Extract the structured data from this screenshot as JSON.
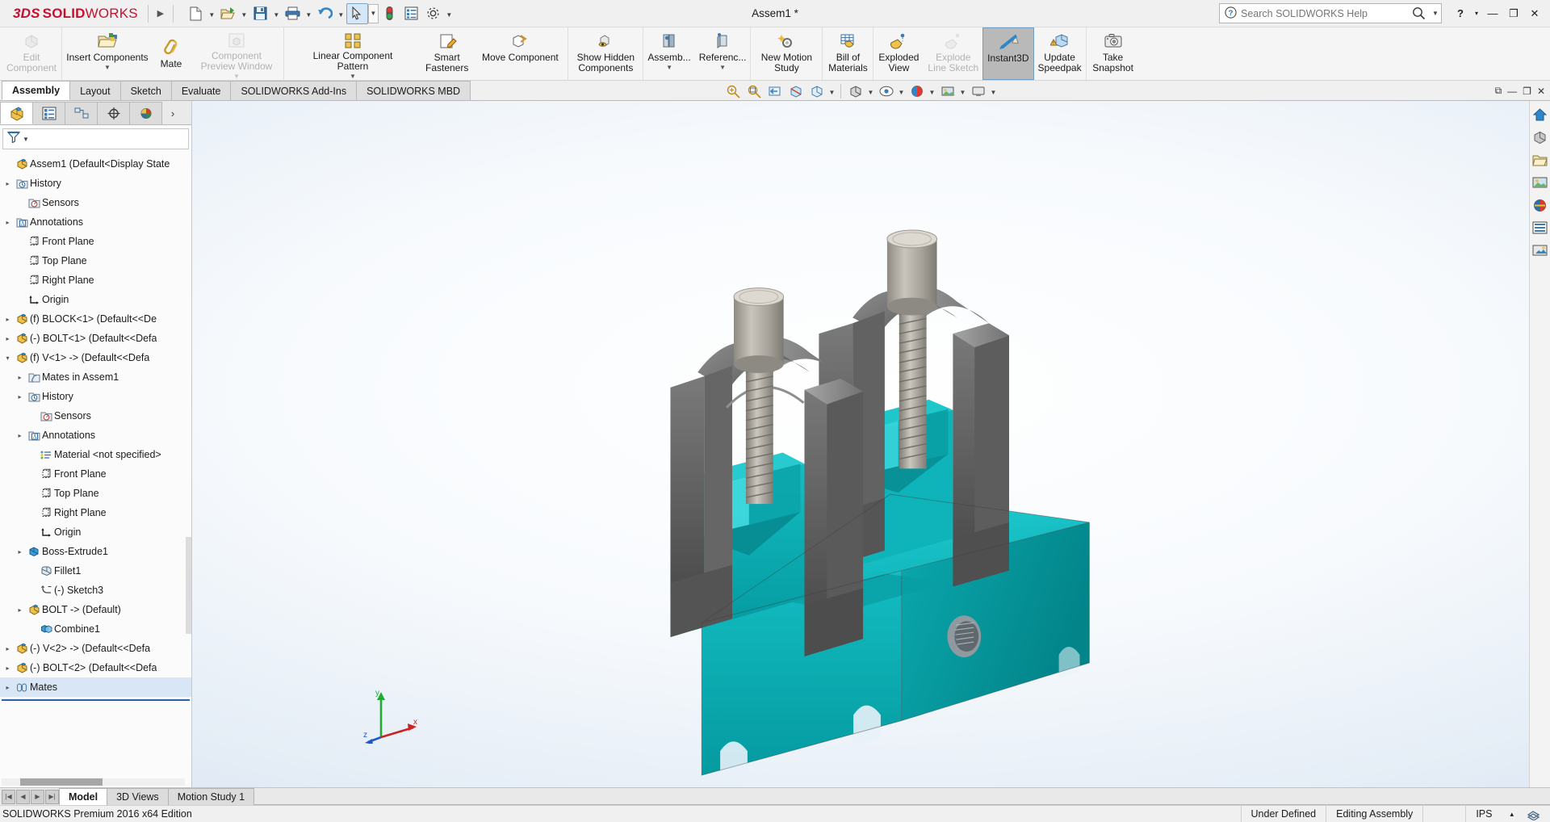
{
  "app": {
    "brand_ds": "3DS",
    "brand_solid": "SOLID",
    "brand_works": "WORKS",
    "document_title": "Assem1 *",
    "edition": "SOLIDWORKS Premium 2016 x64 Edition",
    "accent": "#c8102e",
    "selection_blue": "#d6e8f7"
  },
  "titlebar": {
    "expand_arrow": "▶",
    "quick_access": [
      {
        "name": "new-document",
        "label": "New",
        "caret": true
      },
      {
        "name": "open-document",
        "label": "Open",
        "caret": true
      },
      {
        "name": "save-document",
        "label": "Save",
        "caret": true
      },
      {
        "name": "print-document",
        "label": "Print",
        "caret": true
      },
      {
        "name": "undo",
        "label": "Undo",
        "caret": true
      },
      {
        "name": "select-tool",
        "label": "Select",
        "caret": true,
        "selected": true
      },
      {
        "name": "rebuild",
        "label": "Rebuild"
      },
      {
        "name": "file-properties",
        "label": "File Properties"
      },
      {
        "name": "options",
        "label": "Options",
        "caret": true
      }
    ],
    "search": {
      "placeholder": "Search SOLIDWORKS Help",
      "value": "",
      "help_icon": "?"
    },
    "window_buttons": [
      {
        "name": "help-button",
        "label": "?"
      },
      {
        "name": "help-caret",
        "label": "▾"
      },
      {
        "name": "minimize-button",
        "label": "—"
      },
      {
        "name": "restore-button",
        "label": "❐"
      },
      {
        "name": "close-button",
        "label": "✕"
      }
    ]
  },
  "ribbon": {
    "groups": [
      {
        "buttons": [
          {
            "name": "edit-component",
            "label": "Edit\nComponent",
            "icon": "edit-component-icon",
            "disabled": true,
            "caret": false
          }
        ]
      },
      {
        "buttons": [
          {
            "name": "insert-components",
            "label": "Insert Components",
            "icon": "insert-components-icon",
            "disabled": false,
            "caret": true
          },
          {
            "name": "mate",
            "label": "Mate",
            "icon": "mate-icon",
            "disabled": false,
            "caret": false
          },
          {
            "name": "component-preview-window",
            "label": "Component\nPreview Window",
            "icon": "component-preview-icon",
            "disabled": true,
            "caret": true
          }
        ]
      },
      {
        "buttons": [
          {
            "name": "linear-component-pattern",
            "label": "Linear Component Pattern",
            "icon": "linear-pattern-icon",
            "disabled": false,
            "caret": true
          },
          {
            "name": "smart-fasteners",
            "label": "Smart\nFasteners",
            "icon": "smart-fasteners-icon",
            "disabled": false,
            "caret": false
          },
          {
            "name": "move-component",
            "label": "Move Component",
            "icon": "move-component-icon",
            "disabled": false,
            "caret": false
          }
        ]
      },
      {
        "buttons": [
          {
            "name": "show-hidden-components",
            "label": "Show Hidden\nComponents",
            "icon": "show-hidden-icon",
            "disabled": false,
            "caret": false
          }
        ]
      },
      {
        "buttons": [
          {
            "name": "assembly-features",
            "label": "Assemb...",
            "icon": "assembly-features-icon",
            "disabled": false,
            "caret": true
          },
          {
            "name": "reference-geometry",
            "label": "Referenc...",
            "icon": "reference-geometry-icon",
            "disabled": false,
            "caret": true
          }
        ]
      },
      {
        "buttons": [
          {
            "name": "new-motion-study",
            "label": "New Motion\nStudy",
            "icon": "motion-study-icon",
            "disabled": false,
            "caret": false
          }
        ]
      },
      {
        "buttons": [
          {
            "name": "bill-of-materials",
            "label": "Bill of\nMaterials",
            "icon": "bom-icon",
            "disabled": false,
            "caret": false
          }
        ]
      },
      {
        "buttons": [
          {
            "name": "exploded-view",
            "label": "Exploded\nView",
            "icon": "exploded-view-icon",
            "disabled": false,
            "caret": false
          },
          {
            "name": "explode-line-sketch",
            "label": "Explode\nLine Sketch",
            "icon": "explode-line-icon",
            "disabled": true,
            "caret": false
          },
          {
            "name": "instant3d",
            "label": "Instant3D",
            "icon": "instant3d-icon",
            "disabled": false,
            "caret": false,
            "active": true
          },
          {
            "name": "update-speedpak",
            "label": "Update\nSpeedpak",
            "icon": "update-speedpak-icon",
            "disabled": false,
            "caret": false
          }
        ]
      },
      {
        "buttons": [
          {
            "name": "take-snapshot",
            "label": "Take\nSnapshot",
            "icon": "camera-icon",
            "disabled": false,
            "caret": false
          }
        ]
      }
    ]
  },
  "command_tabs": {
    "tabs": [
      {
        "name": "tab-assembly",
        "label": "Assembly",
        "active": true
      },
      {
        "name": "tab-layout",
        "label": "Layout",
        "active": false
      },
      {
        "name": "tab-sketch",
        "label": "Sketch",
        "active": false
      },
      {
        "name": "tab-evaluate",
        "label": "Evaluate",
        "active": false
      },
      {
        "name": "tab-solidworks-addins",
        "label": "SOLIDWORKS Add-Ins",
        "active": false
      },
      {
        "name": "tab-solidworks-mbd",
        "label": "SOLIDWORKS MBD",
        "active": false
      }
    ],
    "view_tools": [
      {
        "name": "zoom-to-fit-icon",
        "caret": false
      },
      {
        "name": "zoom-to-area-icon",
        "caret": false
      },
      {
        "name": "previous-view-icon",
        "caret": false
      },
      {
        "name": "section-view-icon",
        "caret": false
      },
      {
        "name": "view-orientation-icon",
        "caret": true
      },
      {
        "name": "display-style-icon",
        "caret": true
      },
      {
        "name": "hide-show-items-icon",
        "caret": true
      },
      {
        "name": "edit-appearance-icon",
        "caret": true
      },
      {
        "name": "apply-scene-icon",
        "caret": true
      },
      {
        "name": "view-settings-icon",
        "caret": true
      }
    ],
    "window_controls": [
      {
        "name": "restore-down-doc",
        "label": "⧉"
      },
      {
        "name": "minimize-doc",
        "label": "—"
      },
      {
        "name": "maximize-doc",
        "label": "❐"
      },
      {
        "name": "close-doc",
        "label": "✕"
      }
    ]
  },
  "feature_manager": {
    "panel_tabs": [
      {
        "name": "featuremanager-design-tree-tab",
        "icon": "yellow-cube-icon",
        "active": true
      },
      {
        "name": "property-manager-tab",
        "icon": "property-list-icon",
        "active": false
      },
      {
        "name": "configuration-manager-tab",
        "icon": "configuration-icon",
        "active": false
      },
      {
        "name": "dimxpert-manager-tab",
        "icon": "dimxpert-icon",
        "active": false
      },
      {
        "name": "display-manager-tab",
        "icon": "color-sphere-icon",
        "active": false
      }
    ],
    "panel_more": "›",
    "filter_icon": "filter-icon",
    "filter_placeholder": "",
    "tree": [
      {
        "indent": 0,
        "expander": "",
        "icon": "assembly-icon",
        "label": "Assem1  (Default<Display State"
      },
      {
        "indent": 0,
        "expander": "▸",
        "icon": "history-icon",
        "label": "History"
      },
      {
        "indent": 1,
        "expander": "",
        "icon": "sensors-icon",
        "label": "Sensors"
      },
      {
        "indent": 0,
        "expander": "▸",
        "icon": "annotations-icon",
        "label": "Annotations"
      },
      {
        "indent": 1,
        "expander": "",
        "icon": "plane-icon",
        "label": "Front Plane"
      },
      {
        "indent": 1,
        "expander": "",
        "icon": "plane-icon",
        "label": "Top Plane"
      },
      {
        "indent": 1,
        "expander": "",
        "icon": "plane-icon",
        "label": "Right Plane"
      },
      {
        "indent": 1,
        "expander": "",
        "icon": "origin-icon",
        "label": "Origin"
      },
      {
        "indent": 0,
        "expander": "▸",
        "icon": "component-icon",
        "label": "(f) BLOCK<1> (Default<<De"
      },
      {
        "indent": 0,
        "expander": "▸",
        "icon": "component-icon",
        "label": "(-) BOLT<1> (Default<<Defa"
      },
      {
        "indent": 0,
        "expander": "▾",
        "icon": "component-icon",
        "label": "(f) V<1> -> (Default<<Defa"
      },
      {
        "indent": 1,
        "expander": "▸",
        "icon": "mates-folder-icon",
        "label": "Mates in Assem1"
      },
      {
        "indent": 1,
        "expander": "▸",
        "icon": "history-icon",
        "label": "History"
      },
      {
        "indent": 2,
        "expander": "",
        "icon": "sensors-icon",
        "label": "Sensors"
      },
      {
        "indent": 1,
        "expander": "▸",
        "icon": "annotations-icon",
        "label": "Annotations"
      },
      {
        "indent": 2,
        "expander": "",
        "icon": "material-icon",
        "label": "Material <not specified>"
      },
      {
        "indent": 2,
        "expander": "",
        "icon": "plane-icon",
        "label": "Front Plane"
      },
      {
        "indent": 2,
        "expander": "",
        "icon": "plane-icon",
        "label": "Top Plane"
      },
      {
        "indent": 2,
        "expander": "",
        "icon": "plane-icon",
        "label": "Right Plane"
      },
      {
        "indent": 2,
        "expander": "",
        "icon": "origin-icon",
        "label": "Origin"
      },
      {
        "indent": 1,
        "expander": "▸",
        "icon": "boss-extrude-icon",
        "label": "Boss-Extrude1"
      },
      {
        "indent": 2,
        "expander": "",
        "icon": "fillet-icon",
        "label": "Fillet1"
      },
      {
        "indent": 2,
        "expander": "",
        "icon": "sketch-icon",
        "label": "(-) Sketch3"
      },
      {
        "indent": 1,
        "expander": "▸",
        "icon": "component-icon",
        "label": "BOLT -> (Default)"
      },
      {
        "indent": 2,
        "expander": "",
        "icon": "combine-icon",
        "label": "Combine1"
      },
      {
        "indent": 0,
        "expander": "▸",
        "icon": "component-icon",
        "label": "(-) V<2> -> (Default<<Defa"
      },
      {
        "indent": 0,
        "expander": "▸",
        "icon": "component-icon",
        "label": "(-) BOLT<2> (Default<<Defa"
      },
      {
        "indent": 0,
        "expander": "▸",
        "icon": "mates-icon",
        "label": "Mates"
      }
    ]
  },
  "graphics": {
    "right_toolbar": [
      {
        "name": "view-home-icon"
      },
      {
        "name": "view-orientation-cube-icon"
      },
      {
        "name": "appearances-folder-icon"
      },
      {
        "name": "scenes-icon"
      },
      {
        "name": "decals-icon"
      },
      {
        "name": "display-states-icon"
      },
      {
        "name": "custom-views-icon"
      }
    ],
    "triad": {
      "x_label": "x",
      "y_label": "y",
      "z_label": "z"
    },
    "model": {
      "body_color": "#00b8bd",
      "bracket_color": "#6b6b6b",
      "bolt_color": "#a8a49c"
    }
  },
  "bottom_tabs": {
    "nav_buttons": [
      {
        "name": "first-tab-button",
        "label": "|◀"
      },
      {
        "name": "prev-tab-button",
        "label": "◀"
      },
      {
        "name": "next-tab-button",
        "label": "▶"
      },
      {
        "name": "last-tab-button",
        "label": "▶|"
      }
    ],
    "tabs": [
      {
        "name": "tab-model",
        "label": "Model",
        "active": true
      },
      {
        "name": "tab-3d-views",
        "label": "3D Views",
        "active": false
      },
      {
        "name": "tab-motion-study-1",
        "label": "Motion Study 1",
        "active": false
      }
    ]
  },
  "status_bar": {
    "left": "SOLIDWORKS Premium 2016 x64 Edition",
    "cells": [
      {
        "name": "status-under-defined",
        "label": "Under Defined"
      },
      {
        "name": "status-editing-assembly",
        "label": "Editing Assembly"
      },
      {
        "name": "status-spacer",
        "label": ""
      },
      {
        "name": "status-units",
        "label": "IPS"
      },
      {
        "name": "status-units-caret",
        "label": "▴"
      },
      {
        "name": "status-overlay-icon",
        "label": ""
      }
    ]
  }
}
